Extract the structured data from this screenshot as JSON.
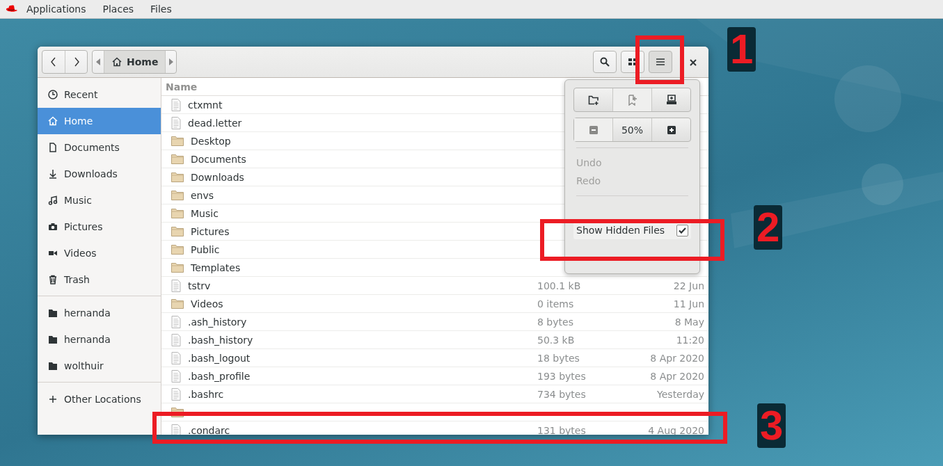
{
  "top_bar": {
    "menus": [
      "Applications",
      "Places",
      "Files"
    ]
  },
  "toolbar": {
    "path": "Home"
  },
  "sidebar": {
    "items": [
      {
        "label": "Recent",
        "selected": false
      },
      {
        "label": "Home",
        "selected": true
      },
      {
        "label": "Documents",
        "selected": false
      },
      {
        "label": "Downloads",
        "selected": false
      },
      {
        "label": "Music",
        "selected": false
      },
      {
        "label": "Pictures",
        "selected": false
      },
      {
        "label": "Videos",
        "selected": false
      },
      {
        "label": "Trash",
        "selected": false
      },
      {
        "label": "hernanda",
        "selected": false
      },
      {
        "label": "hernanda",
        "selected": false
      },
      {
        "label": "wolthuir",
        "selected": false
      },
      {
        "label": "Other Locations",
        "selected": false
      }
    ]
  },
  "table": {
    "columns": [
      "Name"
    ],
    "rows": [
      {
        "name": "ctxmnt",
        "kind": "file"
      },
      {
        "name": "dead.letter",
        "kind": "file"
      },
      {
        "name": "Desktop",
        "kind": "folder"
      },
      {
        "name": "Documents",
        "kind": "folder"
      },
      {
        "name": "Downloads",
        "kind": "folder"
      },
      {
        "name": "envs",
        "kind": "folder"
      },
      {
        "name": "Music",
        "kind": "folder"
      },
      {
        "name": "Pictures",
        "kind": "folder"
      },
      {
        "name": "Public",
        "kind": "folder"
      },
      {
        "name": "Templates",
        "kind": "folder"
      },
      {
        "name": "tstrv",
        "kind": "file",
        "size": "100.1 kB",
        "modified": "22 Jun"
      },
      {
        "name": "Videos",
        "kind": "folder",
        "size": "0 items",
        "modified": "11 Jun"
      },
      {
        "name": ".ash_history",
        "kind": "file",
        "size": "8 bytes",
        "modified": "8 May"
      },
      {
        "name": ".bash_history",
        "kind": "file",
        "size": "50.3 kB",
        "modified": "11:20"
      },
      {
        "name": ".bash_logout",
        "kind": "file",
        "size": "18 bytes",
        "modified": "8 Apr 2020"
      },
      {
        "name": ".bash_profile",
        "kind": "file",
        "size": "193 bytes",
        "modified": "8 Apr 2020"
      },
      {
        "name": ".bashrc",
        "kind": "file",
        "size": "734 bytes",
        "modified": "Yesterday"
      },
      {
        "kind": "folder"
      },
      {
        "name": ".condarc",
        "kind": "file",
        "size": "131 bytes",
        "modified": "4 Aug 2020"
      }
    ]
  },
  "menu_popover": {
    "zoom": "50%",
    "items": [
      {
        "label": "Undo",
        "disabled": true
      },
      {
        "label": "Redo",
        "disabled": true
      }
    ],
    "show_hidden_files": {
      "label": "Show Hidden Files",
      "checked": true
    }
  },
  "annotations": [
    "1",
    "2",
    "3"
  ]
}
